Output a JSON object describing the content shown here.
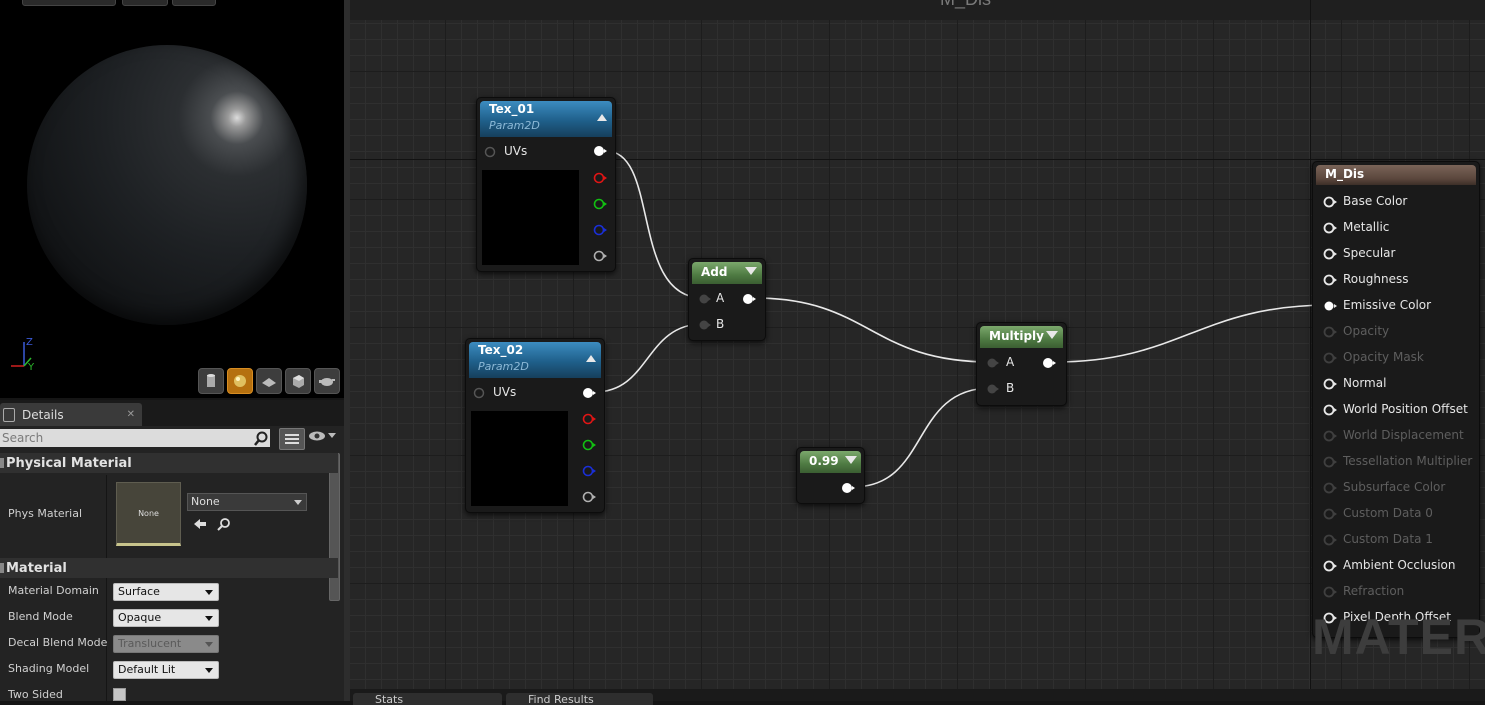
{
  "viewport": {
    "axis": {
      "z": "Z",
      "y": "Y"
    },
    "toolbar": [
      "cylinder-icon",
      "sphere-icon",
      "plane-icon",
      "cube-icon",
      "teapot-icon"
    ]
  },
  "details": {
    "tab_label": "Details",
    "search_placeholder": "Search",
    "physical_material": {
      "header": "Physical Material",
      "phys_material_label": "Phys Material",
      "thumbnail_text": "None",
      "combo_value": "None"
    },
    "material": {
      "header": "Material",
      "properties": [
        {
          "name": "Material Domain",
          "value": "Surface",
          "enabled": true
        },
        {
          "name": "Blend Mode",
          "value": "Opaque",
          "enabled": true
        },
        {
          "name": "Decal Blend Mode",
          "value": "Translucent",
          "enabled": false
        },
        {
          "name": "Shading Model",
          "value": "Default Lit",
          "enabled": true
        },
        {
          "name": "Two Sided",
          "value": "",
          "enabled": true
        }
      ]
    }
  },
  "graph": {
    "title": "M_Dis",
    "watermark": "MATER",
    "nodes": {
      "tex01": {
        "title": "Tex_01",
        "subtitle": "Param2D",
        "input": "UVs"
      },
      "tex02": {
        "title": "Tex_02",
        "subtitle": "Param2D",
        "input": "UVs"
      },
      "add": {
        "title": "Add",
        "inputs": [
          "A",
          "B"
        ]
      },
      "multiply": {
        "title": "Multiply",
        "inputs": [
          "A",
          "B"
        ]
      },
      "constant": {
        "title": "0.99"
      },
      "result": {
        "title": "M_Dis",
        "pins": [
          {
            "label": "Base Color",
            "enabled": true
          },
          {
            "label": "Metallic",
            "enabled": true
          },
          {
            "label": "Specular",
            "enabled": true
          },
          {
            "label": "Roughness",
            "enabled": true
          },
          {
            "label": "Emissive Color",
            "enabled": true,
            "connected": true
          },
          {
            "label": "Opacity",
            "enabled": false
          },
          {
            "label": "Opacity Mask",
            "enabled": false
          },
          {
            "label": "Normal",
            "enabled": true
          },
          {
            "label": "World Position Offset",
            "enabled": true
          },
          {
            "label": "World Displacement",
            "enabled": false
          },
          {
            "label": "Tessellation Multiplier",
            "enabled": false
          },
          {
            "label": "Subsurface Color",
            "enabled": false
          },
          {
            "label": "Custom Data 0",
            "enabled": false
          },
          {
            "label": "Custom Data 1",
            "enabled": false
          },
          {
            "label": "Ambient Occlusion",
            "enabled": true
          },
          {
            "label": "Refraction",
            "enabled": false
          },
          {
            "label": "Pixel Depth Offset",
            "enabled": true
          }
        ]
      }
    },
    "pin_colors": {
      "white": "#ffffff",
      "red": "#e01515",
      "green": "#12c012",
      "blue": "#1a2fd8",
      "grey": "#b0b0b0"
    }
  },
  "bottom_tabs": [
    "Stats",
    "Find Results"
  ]
}
